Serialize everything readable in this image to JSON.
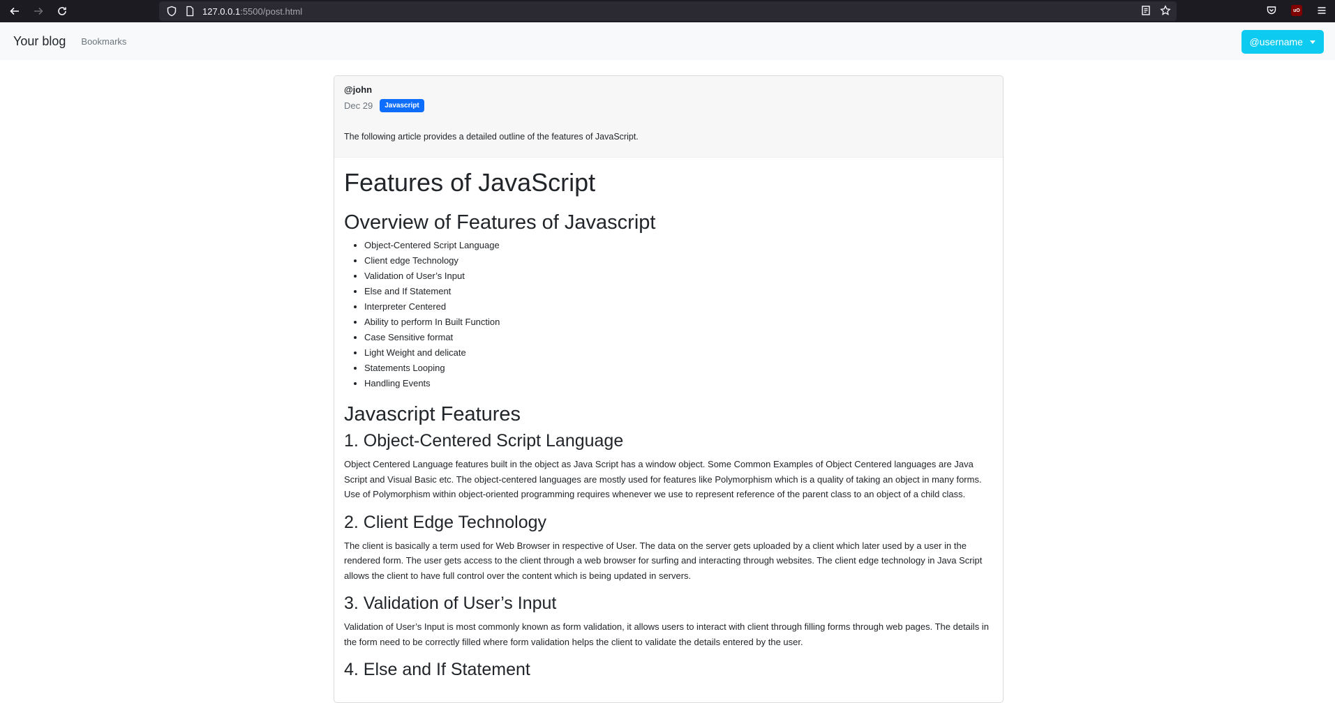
{
  "browser": {
    "url_host": "127.0.0.1",
    "url_path": ":5500/post.html"
  },
  "navbar": {
    "brand": "Your blog",
    "links": [
      "Bookmarks"
    ],
    "user_button": "@username"
  },
  "post": {
    "author": "@john",
    "date": "Dec 29",
    "tag": "Javascript",
    "summary": "The following article provides a detailed outline of the features of JavaScript.",
    "title": "Features of JavaScript",
    "overview_heading": "Overview of Features of Javascript",
    "overview_items": [
      "Object-Centered Script Language",
      "Client edge Technology",
      "Validation of User’s Input",
      "Else and If Statement",
      "Interpreter Centered",
      "Ability to perform In Built Function",
      "Case Sensitive format",
      "Light Weight and delicate",
      "Statements Looping",
      "Handling Events"
    ],
    "features_heading": "Javascript Features",
    "sections": [
      {
        "heading": "1. Object-Centered Script Language",
        "text": "Object Centered Language features built in the object as Java Script has a window object. Some Common Examples of Object Centered languages are Java Script and Visual Basic etc. The object-centered languages are mostly used for features like Polymorphism which is a quality of taking an object in many forms. Use of Polymorphism within object-oriented programming requires whenever we use to represent reference of the parent class to an object of a child class."
      },
      {
        "heading": "2. Client Edge Technology",
        "text": "The client is basically a term used for Web Browser in respective of User. The data on the server gets uploaded by a client which later used by a user in the rendered form. The user gets access to the client through a web browser for surfing and interacting through websites. The client edge technology in Java Script allows the client to have full control over the content which is being updated in servers."
      },
      {
        "heading": "3. Validation of User’s Input",
        "text": "Validation of User’s Input is most commonly known as form validation, it allows users to interact with client through filling forms through web pages. The details in the form need to be correctly filled where form validation helps the client to validate the details entered by the user."
      },
      {
        "heading": "4. Else and If Statement",
        "text": ""
      }
    ]
  }
}
